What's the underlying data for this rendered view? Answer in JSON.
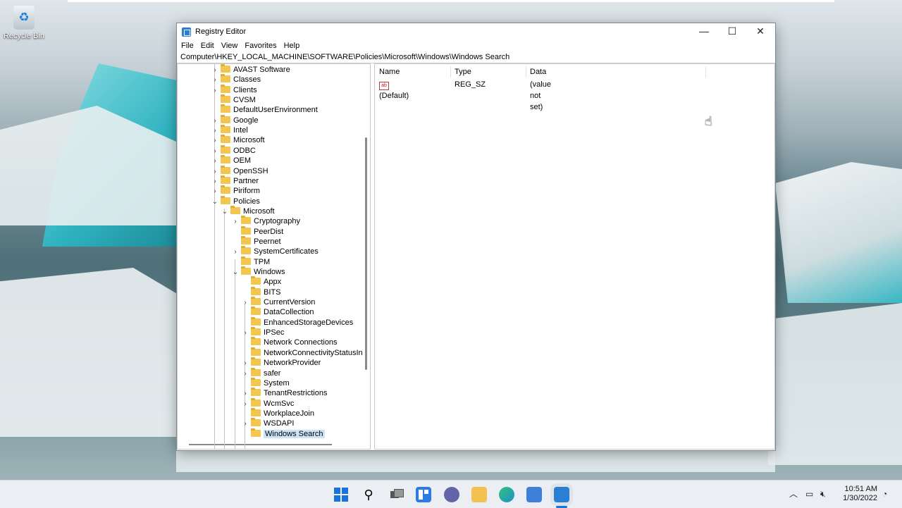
{
  "desktop": {
    "recycle_bin_label": "Recycle Bin"
  },
  "window": {
    "title": "Registry Editor",
    "controls": {
      "minimize": "—",
      "maximize": "☐",
      "close": "✕"
    },
    "menu": [
      "File",
      "Edit",
      "View",
      "Favorites",
      "Help"
    ],
    "address": "Computer\\HKEY_LOCAL_MACHINE\\SOFTWARE\\Policies\\Microsoft\\Windows\\Windows Search"
  },
  "tree": [
    {
      "label": "AVAST Software",
      "level": 0,
      "expander": "›",
      "selected": false
    },
    {
      "label": "Classes",
      "level": 0,
      "expander": "›",
      "selected": false
    },
    {
      "label": "Clients",
      "level": 0,
      "expander": "›",
      "selected": false
    },
    {
      "label": "CVSM",
      "level": 0,
      "expander": "",
      "selected": false
    },
    {
      "label": "DefaultUserEnvironment",
      "level": 0,
      "expander": "",
      "selected": false
    },
    {
      "label": "Google",
      "level": 0,
      "expander": "›",
      "selected": false
    },
    {
      "label": "Intel",
      "level": 0,
      "expander": "›",
      "selected": false
    },
    {
      "label": "Microsoft",
      "level": 0,
      "expander": "›",
      "selected": false
    },
    {
      "label": "ODBC",
      "level": 0,
      "expander": "›",
      "selected": false
    },
    {
      "label": "OEM",
      "level": 0,
      "expander": "›",
      "selected": false
    },
    {
      "label": "OpenSSH",
      "level": 0,
      "expander": "›",
      "selected": false
    },
    {
      "label": "Partner",
      "level": 0,
      "expander": "›",
      "selected": false
    },
    {
      "label": "Piriform",
      "level": 0,
      "expander": "›",
      "selected": false
    },
    {
      "label": "Policies",
      "level": 0,
      "expander": "⌄",
      "selected": false
    },
    {
      "label": "Microsoft",
      "level": 1,
      "expander": "⌄",
      "selected": false
    },
    {
      "label": "Cryptography",
      "level": 2,
      "expander": "›",
      "selected": false
    },
    {
      "label": "PeerDist",
      "level": 2,
      "expander": "",
      "selected": false
    },
    {
      "label": "Peernet",
      "level": 2,
      "expander": "",
      "selected": false
    },
    {
      "label": "SystemCertificates",
      "level": 2,
      "expander": "›",
      "selected": false
    },
    {
      "label": "TPM",
      "level": 2,
      "expander": "",
      "selected": false
    },
    {
      "label": "Windows",
      "level": 2,
      "expander": "⌄",
      "selected": false
    },
    {
      "label": "Appx",
      "level": 3,
      "expander": "",
      "selected": false
    },
    {
      "label": "BITS",
      "level": 3,
      "expander": "",
      "selected": false
    },
    {
      "label": "CurrentVersion",
      "level": 3,
      "expander": "›",
      "selected": false
    },
    {
      "label": "DataCollection",
      "level": 3,
      "expander": "",
      "selected": false
    },
    {
      "label": "EnhancedStorageDevices",
      "level": 3,
      "expander": "",
      "selected": false
    },
    {
      "label": "IPSec",
      "level": 3,
      "expander": "›",
      "selected": false
    },
    {
      "label": "Network Connections",
      "level": 3,
      "expander": "",
      "selected": false
    },
    {
      "label": "NetworkConnectivityStatusIn",
      "level": 3,
      "expander": "",
      "selected": false
    },
    {
      "label": "NetworkProvider",
      "level": 3,
      "expander": "›",
      "selected": false
    },
    {
      "label": "safer",
      "level": 3,
      "expander": "›",
      "selected": false
    },
    {
      "label": "System",
      "level": 3,
      "expander": "",
      "selected": false
    },
    {
      "label": "TenantRestrictions",
      "level": 3,
      "expander": "›",
      "selected": false
    },
    {
      "label": "WcmSvc",
      "level": 3,
      "expander": "›",
      "selected": false
    },
    {
      "label": "WorkplaceJoin",
      "level": 3,
      "expander": "",
      "selected": false
    },
    {
      "label": "WSDAPI",
      "level": 3,
      "expander": "›",
      "selected": false
    },
    {
      "label": "Windows Search",
      "level": 3,
      "expander": "",
      "selected": true
    }
  ],
  "values_list": {
    "columns": [
      "Name",
      "Type",
      "Data"
    ],
    "rows": [
      {
        "name": "(Default)",
        "type": "REG_SZ",
        "data": "(value not set)",
        "icon": "ab"
      }
    ]
  },
  "taskbar": {
    "icons": [
      "start-icon",
      "search-icon",
      "task-view-icon",
      "widgets-icon",
      "chat-icon",
      "file-explorer-icon",
      "edge-icon",
      "store-icon",
      "registry-editor-icon"
    ],
    "colors": {
      "start": "#1a73d9",
      "widgets": "#2c7be5",
      "chat": "#6264a7",
      "explorer": "#f2c14e",
      "edge": "#1e90c8",
      "store": "#3d7fd9",
      "regedit": "#2a7fd4"
    },
    "tray": {
      "chevron": "︿",
      "network": "▭",
      "volume": "🔇︎",
      "clock_time": "10:51 AM",
      "clock_date": "1/30/2022"
    }
  }
}
